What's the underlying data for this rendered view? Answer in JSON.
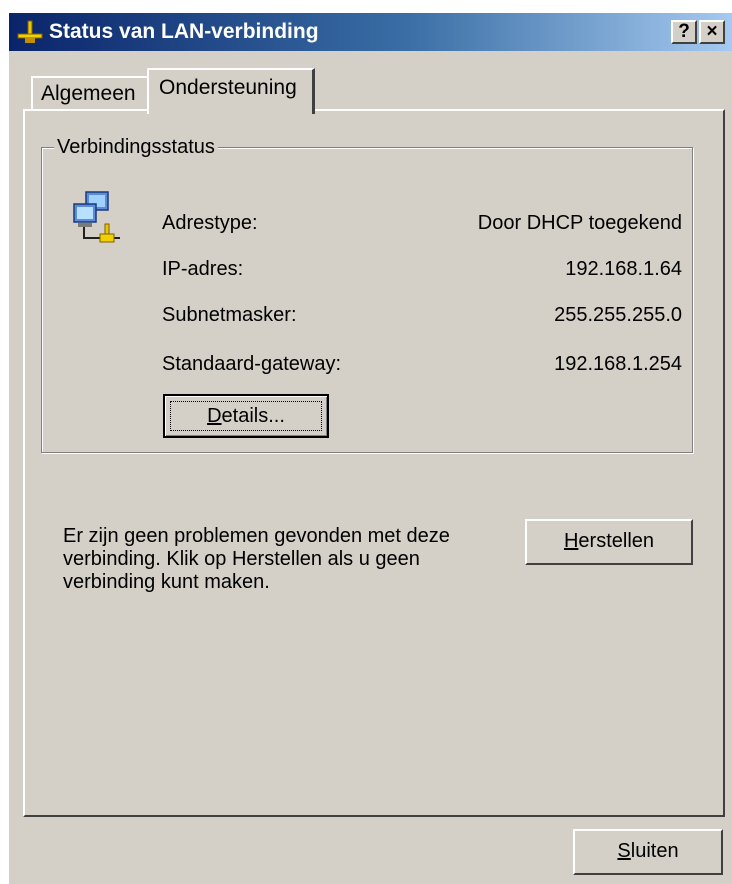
{
  "window": {
    "title": "Status van LAN-verbinding",
    "help_button": "?",
    "close_button": "×"
  },
  "tabs": [
    {
      "label": "Algemeen",
      "selected": false
    },
    {
      "label": "Ondersteuning",
      "selected": true
    }
  ],
  "connection_status": {
    "legend": "Verbindingsstatus",
    "fields": [
      {
        "label": "Adrestype:",
        "value": "Door DHCP toegekend"
      },
      {
        "label": "IP-adres:",
        "value": "192.168.1.64"
      },
      {
        "label": "Subnetmasker:",
        "value": "255.255.255.0"
      },
      {
        "label": "Standaard-gateway:",
        "value": "192.168.1.254"
      }
    ],
    "details_button": {
      "mnemonic": "D",
      "rest": "etails..."
    }
  },
  "repair": {
    "message": "Er zijn geen problemen gevonden met deze verbinding. Klik op Herstellen als u geen verbinding kunt maken.",
    "button": {
      "mnemonic": "H",
      "rest": "erstellen"
    }
  },
  "footer": {
    "close_button": {
      "mnemonic": "S",
      "rest": "luiten"
    }
  },
  "colors": {
    "dialog_face": "#d4d0c8",
    "title_gradient_start": "#0a246a",
    "title_gradient_end": "#a6caf0"
  }
}
